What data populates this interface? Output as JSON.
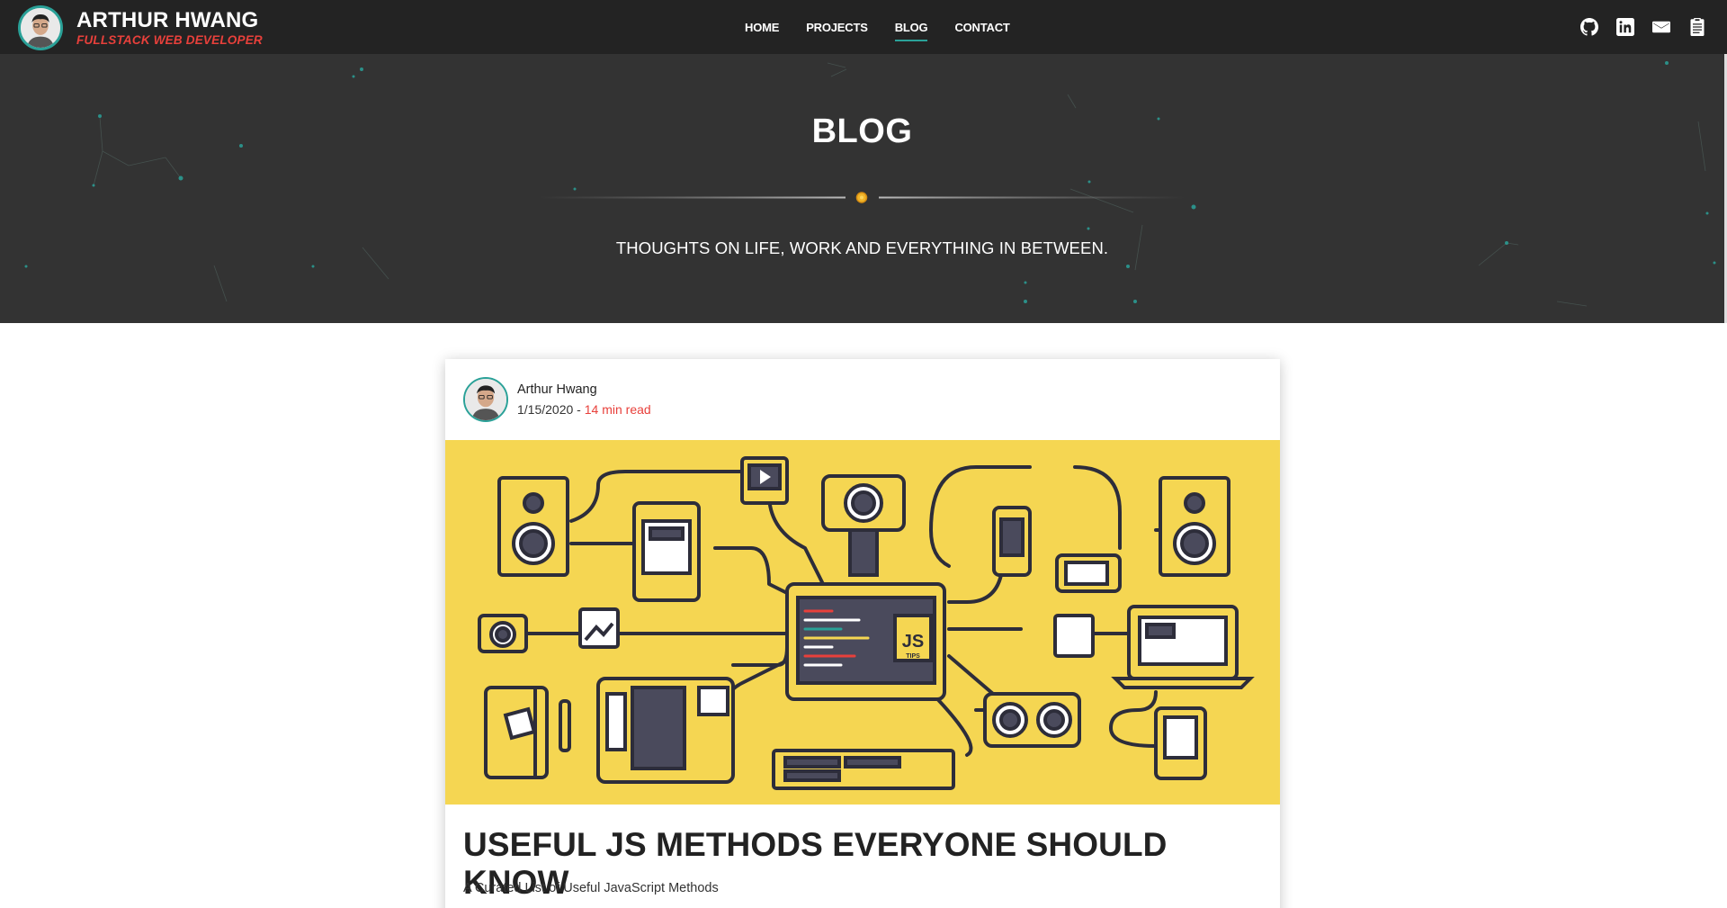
{
  "brand": {
    "name": "ARTHUR HWANG",
    "tagline": "FULLSTACK WEB DEVELOPER"
  },
  "nav": {
    "items": [
      {
        "label": "HOME",
        "active": false
      },
      {
        "label": "PROJECTS",
        "active": false
      },
      {
        "label": "BLOG",
        "active": true
      },
      {
        "label": "CONTACT",
        "active": false
      }
    ],
    "icons": [
      "github-icon",
      "linkedin-icon",
      "mail-icon",
      "resume-icon"
    ]
  },
  "hero": {
    "title": "BLOG",
    "subtitle": "THOUGHTS ON LIFE, WORK AND EVERYTHING IN BETWEEN."
  },
  "post": {
    "author": "Arthur Hwang",
    "date": "1/15/2020",
    "separator": " - ",
    "read_time": "14 min read",
    "title": "USEFUL JS METHODS EVERYONE SHOULD KNOW",
    "description": "A Curated List of Useful JavaScript Methods",
    "image_text": "JS",
    "image_subtext": "TIPS"
  },
  "colors": {
    "navbar": "#232323",
    "hero": "#333333",
    "accent_teal": "#2aa198",
    "accent_red": "#e8403b",
    "image_bg": "#f5d652",
    "divider_dot": "#f0b429"
  }
}
